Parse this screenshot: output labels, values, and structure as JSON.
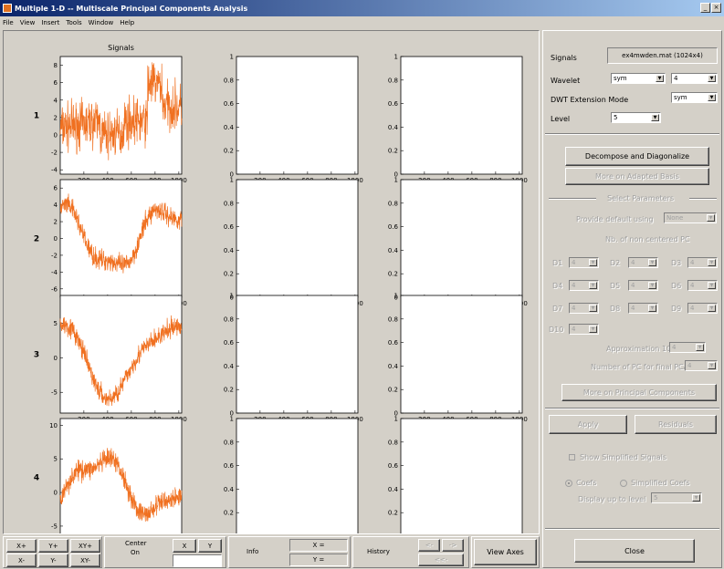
{
  "window": {
    "title": "Multiple 1-D -- Multiscale Principal Components Analysis",
    "min_label": "_",
    "close_label": "×"
  },
  "menu": [
    "File",
    "View",
    "Insert",
    "Tools",
    "Window",
    "Help"
  ],
  "plots": {
    "column_title": "Signals",
    "row_labels": [
      "1",
      "2",
      "3",
      "4"
    ],
    "x_ticks": [
      "200",
      "400",
      "600",
      "800",
      "1000"
    ],
    "empty_y_ticks": [
      "0",
      "0.2",
      "0.4",
      "0.6",
      "0.8",
      "1"
    ],
    "signal_y_ticks": [
      [
        "8",
        "6",
        "4",
        "2",
        "0",
        "-2",
        "-4"
      ],
      [
        "6",
        "4",
        "2",
        "0",
        "-2",
        "-4",
        "-6"
      ],
      [
        "5",
        "0",
        "-5"
      ],
      [
        "10",
        "5",
        "0",
        "-5"
      ]
    ],
    "signal_color": "#f07020"
  },
  "panel": {
    "signals_label": "Signals",
    "signals_file": "ex4mwden.mat  (1024x4)",
    "wavelet_label": "Wavelet",
    "wavelet_family": "sym",
    "wavelet_order": "4",
    "dwt_label": "DWT Extension Mode",
    "dwt_mode": "sym",
    "level_label": "Level",
    "level_value": "5",
    "decompose_label": "Decompose and Diagonalize",
    "more_adapted_label": "More on Adapted Basis",
    "select_params_label": "Select Parameters",
    "provide_default_label": "Provide default using",
    "provide_default_value": "None",
    "nb_pc_label": "Nb. of non centered PC",
    "detail_levels": [
      {
        "label": "D1",
        "value": "4"
      },
      {
        "label": "D2",
        "value": "4"
      },
      {
        "label": "D3",
        "value": "4"
      },
      {
        "label": "D4",
        "value": "4"
      },
      {
        "label": "D5",
        "value": "4"
      },
      {
        "label": "D6",
        "value": "4"
      },
      {
        "label": "D7",
        "value": "4"
      },
      {
        "label": "D8",
        "value": "4"
      },
      {
        "label": "D9",
        "value": "4"
      },
      {
        "label": "D10",
        "value": "4"
      }
    ],
    "approx_label": "Approximation 10",
    "approx_value": "4",
    "final_pca_label": "Number of PC for final PCA",
    "final_pca_value": "4",
    "more_pc_label": "More on Principal Components",
    "apply_label": "Apply",
    "residuals_label": "Residuals",
    "show_simplified_label": "Show Simplified Signals",
    "coefs_label": "Coefs",
    "simplified_coefs_label": "Simplified Coefs",
    "display_level_label": "Display up to level",
    "display_level_value": "5",
    "close_label": "Close"
  },
  "bottom": {
    "xplus": "X+",
    "yplus": "Y+",
    "xyplus": "XY+",
    "xminus": "X-",
    "yminus": "Y-",
    "xyminus": "XY-",
    "center_label": "Center",
    "center_on_label": "On",
    "x_btn": "X",
    "y_btn": "Y",
    "info_label": "Info",
    "x_readout": "X =",
    "y_readout": "Y =",
    "history_label": "History",
    "hist_back": "<-",
    "hist_fwd": "->",
    "hist_reset": "<<-",
    "view_axes_label": "View Axes"
  }
}
